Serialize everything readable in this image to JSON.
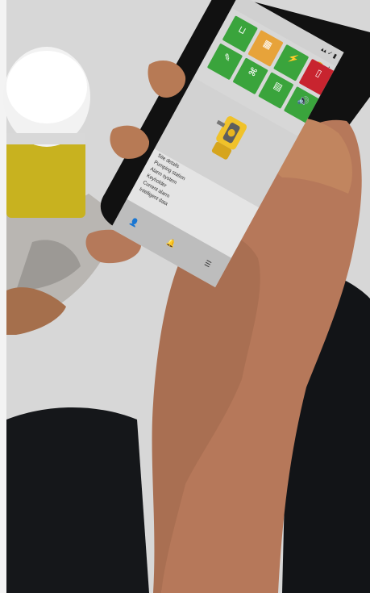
{
  "status_icons": "▴▴ ✓ ▮",
  "avatar_glyph": "♟",
  "tiles": [
    {
      "label": "",
      "color": "#3aa43c",
      "icon": "open-box-icon"
    },
    {
      "label": "",
      "color": "#e7a33a",
      "icon": "panel-icon"
    },
    {
      "label": "",
      "color": "#3aa43c",
      "icon": "plug-icon"
    },
    {
      "label": "",
      "color": "#3aa43c",
      "icon": "wrench-icon"
    },
    {
      "label": "",
      "color": "#3aa43c",
      "icon": "network-icon"
    },
    {
      "label": "",
      "color": "#3aa43c",
      "icon": "document-icon"
    },
    {
      "label": "",
      "color": "#c8242f",
      "icon": "phone-icon"
    },
    {
      "label": "",
      "color": "#3aa43c",
      "icon": "speaker-icon"
    }
  ],
  "menu": {
    "items": [
      "Site details",
      "Pumping station",
      "Alarm system",
      "Keyholder",
      "Current alarm",
      "Intelligent data"
    ]
  },
  "nav": {
    "items": [
      "user-icon",
      "bell-icon",
      "menu-icon"
    ]
  }
}
